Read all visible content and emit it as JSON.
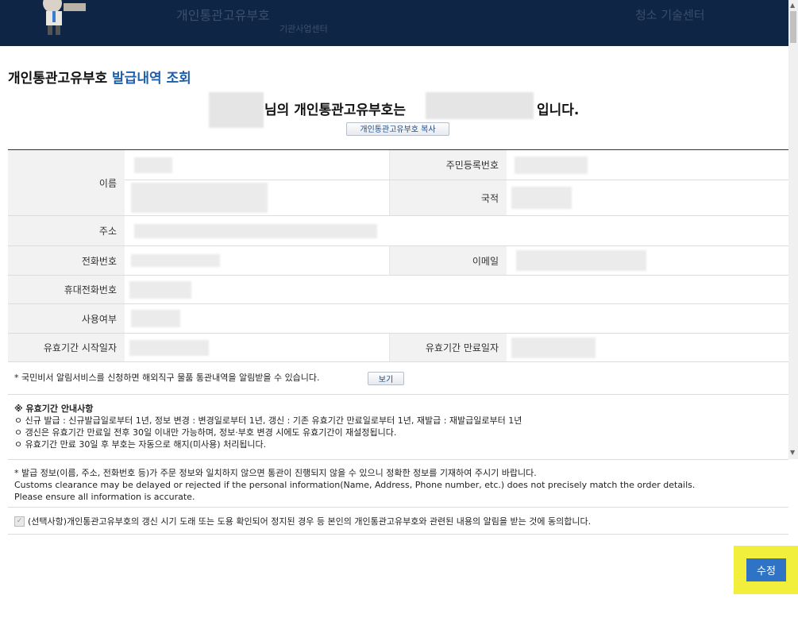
{
  "banner": {
    "ghost_title": "개인통관고유부호",
    "ghost_sub": "기관사업센터",
    "ghost_right": "청소 기술센터"
  },
  "page": {
    "title_main": "개인통관고유부호",
    "title_accent": "발급내역 조회",
    "owner_text_1": "님의 개인통관고유부호는",
    "owner_text_2": "입니다.",
    "copy_button": "개인통관고유부호 복사"
  },
  "table": {
    "name_label": "이름",
    "rrn_label": "주민등록번호",
    "nationality_label": "국적",
    "address_label": "주소",
    "phone_label": "전화번호",
    "email_label": "이메일",
    "mobile_label": "휴대전화번호",
    "usage_label": "사용여부",
    "start_label": "유효기간 시작일자",
    "end_label": "유효기간 만료일자"
  },
  "notice": {
    "alert_service": "* 국민비서 알림서비스를 신청하면 해외직구 물품 통관내역을 알림받을 수 있습니다.",
    "view_button": "보기"
  },
  "guide": {
    "title": "※ 유효기간 안내사항",
    "line1": "ㅇ 신규 발급 : 신규발급일로부터 1년, 정보 변경 : 변경일로부터 1년, 갱신 : 기존 유효기간 만료일로부터 1년, 재발급 : 재발급일로부터 1년",
    "line2": "ㅇ 갱신은 유효기간 만료일 전후 30일 이내만 가능하며, 정보·부호 변경 시에도 유효기간이 재설정됩니다.",
    "line3": "ㅇ 유효기간 만료 30일 후 부호는 자동으로 해지(미사용) 처리됩니다."
  },
  "warning": {
    "line1": "* 발급 정보(이름, 주소, 전화번호 등)가 주문 정보와 일치하지 않으면 통관이 진행되지 않을 수 있으니 정확한 정보를 기재하여 주시기 바랍니다.",
    "line2": "Customs clearance may be delayed or rejected if the personal information(Name, Address, Phone number, etc.) does not precisely match the order details.",
    "line3": "Please ensure all information is accurate."
  },
  "consent": {
    "text": "(선택사항)개인통관고유부호의 갱신 시기 도래 또는 도용 확인되어 정지된 경우 등 본인의 개인통관고유부호와 관련된 내용의 알림을 받는 것에 동의합니다.",
    "checked": true
  },
  "actions": {
    "save_button": "수정"
  },
  "colors": {
    "accent": "#1f5ea8",
    "button_blue": "#2f73c6",
    "highlight": "#f2ee3c",
    "banner": "#0f2545"
  }
}
